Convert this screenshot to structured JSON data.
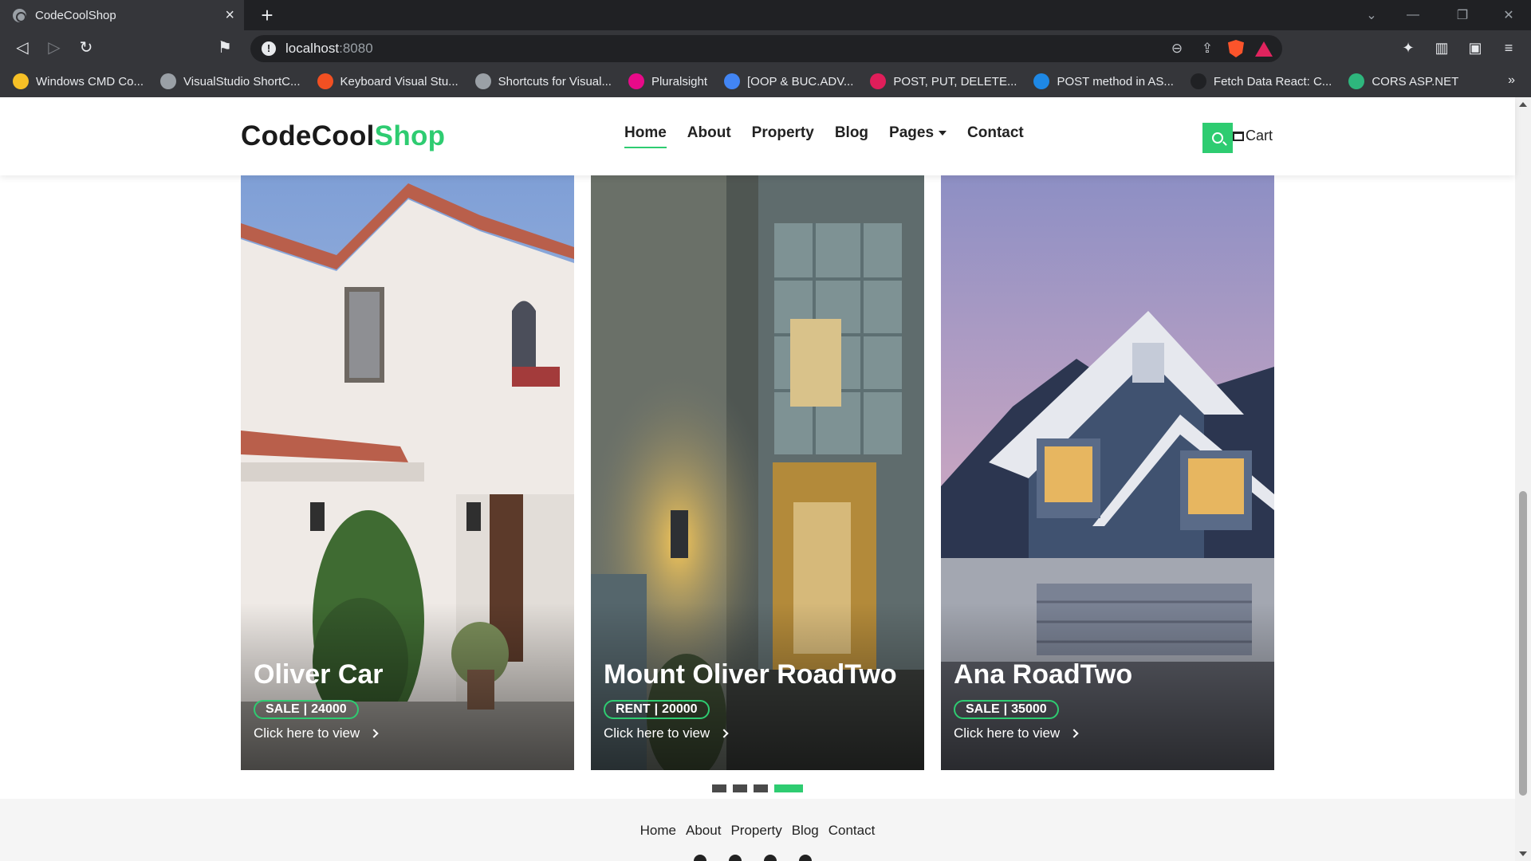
{
  "browser": {
    "tab_title": "CodeCoolShop",
    "url_host": "localhost",
    "url_port": ":8080",
    "bookmarks": [
      {
        "label": "Windows CMD Co...",
        "color": "#f6c026"
      },
      {
        "label": "VisualStudio ShortC...",
        "color": "#9aa0a6"
      },
      {
        "label": "Keyboard Visual Stu...",
        "color": "#f25022"
      },
      {
        "label": "Shortcuts for Visual...",
        "color": "#9aa0a6"
      },
      {
        "label": "Pluralsight",
        "color": "#e80a89"
      },
      {
        "label": "[OOP & BUC.ADV...",
        "color": "#4285f4"
      },
      {
        "label": "POST, PUT, DELETE...",
        "color": "#e01e5a"
      },
      {
        "label": "POST method in AS...",
        "color": "#1e88e5"
      },
      {
        "label": "Fetch Data React: C...",
        "color": "#202124"
      },
      {
        "label": "CORS ASP.NET",
        "color": "#2eb67d"
      }
    ]
  },
  "site": {
    "logo_main": "CodeCool",
    "logo_accent": "Shop",
    "accent_color": "#2ecc71",
    "nav": [
      "Home",
      "About",
      "Property",
      "Blog",
      "Pages",
      "Contact"
    ],
    "cart_label": "Cart",
    "cards": [
      {
        "title": "Oliver Car",
        "type": "SALE",
        "price": "24000",
        "cta": "Click here to view"
      },
      {
        "title": "Mount Oliver RoadTwo",
        "type": "RENT",
        "price": "20000",
        "cta": "Click here to view"
      },
      {
        "title": "Ana RoadTwo",
        "type": "SALE",
        "price": "35000",
        "cta": "Click here to view"
      }
    ],
    "carousel_active_index": 3,
    "footer_links": [
      "Home",
      "About",
      "Property",
      "Blog",
      "Contact"
    ]
  }
}
